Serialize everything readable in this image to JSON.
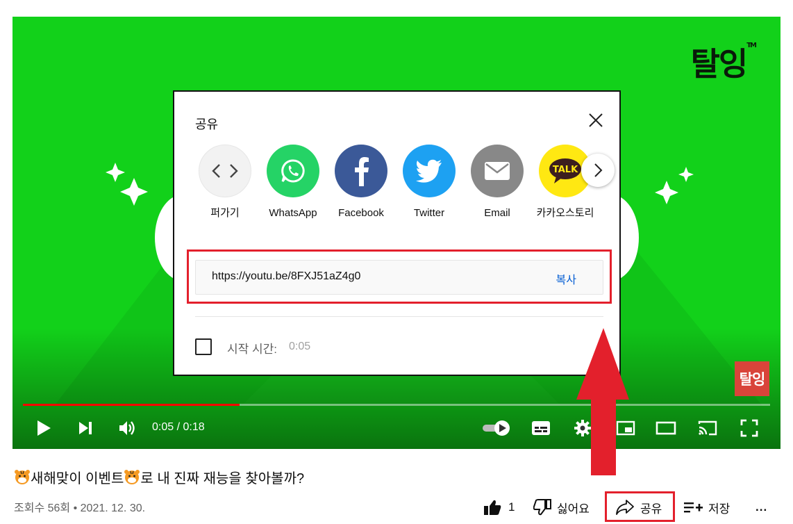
{
  "player": {
    "brand_logo": "탈잉",
    "brand_logo_tm": "TM",
    "corner_badge": "탈잉",
    "progress_fraction": 0.29,
    "current_time": "0:05",
    "duration": "0:18",
    "time_display": "0:05 / 0:18",
    "accent_color": "#12d11a",
    "progress_color": "#ff0000"
  },
  "share_dialog": {
    "title": "공유",
    "close_icon": "close-icon",
    "targets": [
      {
        "label": "퍼가기",
        "icon": "embed-icon",
        "color": "#f2f2f2"
      },
      {
        "label": "WhatsApp",
        "icon": "whatsapp-icon",
        "color": "#25d366"
      },
      {
        "label": "Facebook",
        "icon": "facebook-icon",
        "color": "#3b5998"
      },
      {
        "label": "Twitter",
        "icon": "twitter-icon",
        "color": "#1da1f2"
      },
      {
        "label": "Email",
        "icon": "email-icon",
        "color": "#888888"
      },
      {
        "label": "카카오스토리",
        "icon": "kakao-talk-icon",
        "color": "#ffe812"
      }
    ],
    "next_icon": "chevron-right-icon",
    "link": "https://youtu.be/8FXJ51aZ4g0",
    "copy_label": "복사",
    "start_at_label": "시작 시간:",
    "start_at_value": "0:05",
    "link_color": "#065fd4"
  },
  "video": {
    "title": "새해맞이 이벤트",
    "title_suffix": "로 내 진짜 재능을 찾아볼까?",
    "views": "조회수 56회",
    "separator": "•",
    "date": "2021. 12. 30.",
    "like_count": "1",
    "dislike_label": "싫어요",
    "share_label": "공유",
    "save_label": "저장",
    "more_label": "..."
  },
  "annotation_color": "#e3202c"
}
